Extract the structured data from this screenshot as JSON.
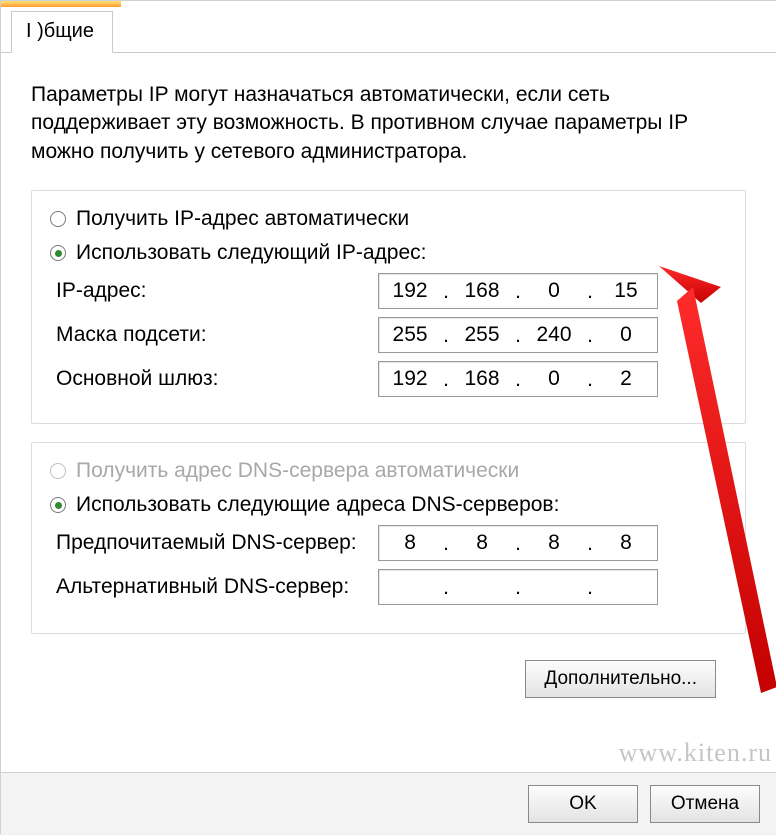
{
  "tab_label": "I )бщие",
  "description": "Параметры IP могут назначаться автоматически, если сеть поддерживает эту возможность. В противном случае параметры IP можно получить у сетевого администратора.",
  "ip_group": {
    "radio_auto": "Получить IP-адрес автоматически",
    "radio_manual": "Использовать следующий IP-адрес:",
    "ip_label": "IP-адрес:",
    "mask_label": "Маска подсети:",
    "gateway_label": "Основной шлюз:",
    "ip": [
      "192",
      "168",
      "0",
      "15"
    ],
    "mask": [
      "255",
      "255",
      "240",
      "0"
    ],
    "gateway": [
      "192",
      "168",
      "0",
      "2"
    ]
  },
  "dns_group": {
    "radio_auto": "Получить адрес DNS-сервера автоматически",
    "radio_manual": "Использовать следующие адреса DNS-серверов:",
    "pref_label": "Предпочитаемый DNS-сервер:",
    "alt_label": "Альтернативный DNS-сервер:",
    "pref": [
      "8",
      "8",
      "8",
      "8"
    ],
    "alt": [
      "",
      "",
      "",
      ""
    ]
  },
  "buttons": {
    "advanced": "Дополнительно...",
    "ok": "OK",
    "cancel": "Отмена"
  },
  "watermark": "www.kiten.ru"
}
